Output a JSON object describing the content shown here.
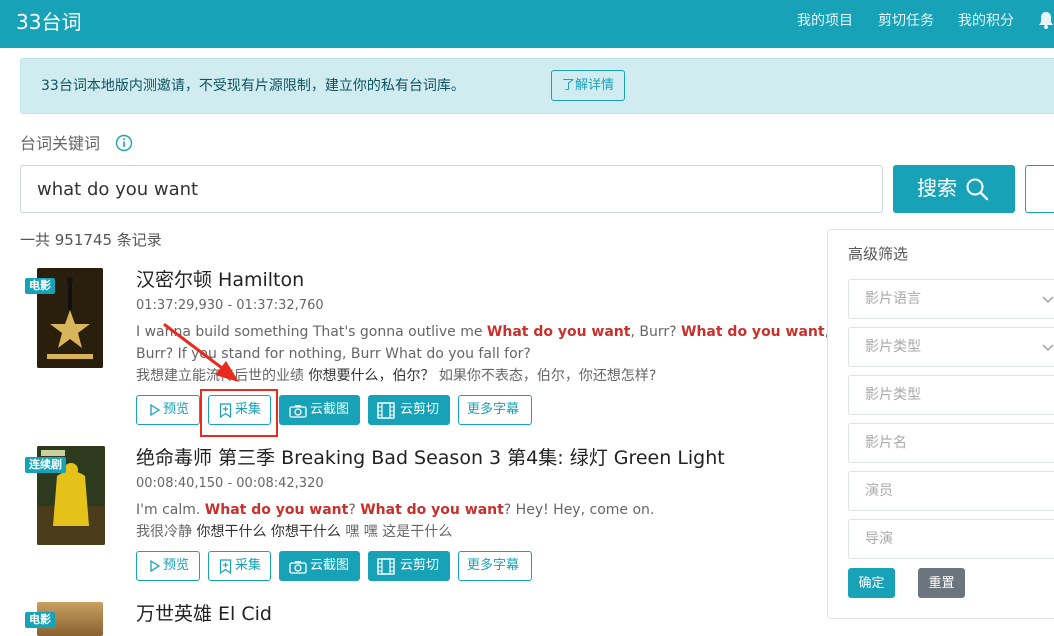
{
  "header": {
    "brand": "33台词",
    "nav": [
      "我的项目",
      "剪切任务",
      "我的积分"
    ],
    "bg_color": "#17a2b8"
  },
  "alert": {
    "text": "33台词本地版内测邀请，不受现有片源限制，建立你的私有台词库。",
    "button": "了解详情"
  },
  "search": {
    "label": "台词关键词",
    "value": "what do you want",
    "button": "搜索",
    "count_text": "一共 951745 条记录"
  },
  "results": [
    {
      "badge": "电影",
      "title": "汉密尔顿 Hamilton",
      "time": "01:37:29,930 - 01:37:32,760",
      "en_line1": [
        "I wanna build something That's gonna outlive me  ",
        "What do you want",
        ", Burr? ",
        "What do you want",
        ","
      ],
      "en_line2": "Burr? If you stand for nothing, Burr What do you fall for?",
      "cn_line": [
        "我想建立能流传后世的业绩  ",
        "你想要什么，伯尔？",
        "  如果你不表态，伯尔，你还想怎样?"
      ],
      "actions": [
        "预览",
        "采集",
        "云截图",
        "云剪切",
        "更多字幕"
      ]
    },
    {
      "badge": "连续剧",
      "title": "绝命毒师 第三季 Breaking Bad Season 3 第4集: 绿灯 Green Light",
      "time": "00:08:40,150 - 00:08:42,320",
      "en_line1": [
        "I'm calm.  ",
        "What do you want",
        "? ",
        "What do you want",
        "? Hey! Hey, come on."
      ],
      "cn_line": [
        "我很冷静  ",
        "你想干什么 你想干什么",
        " 嘿 嘿 这是干什么"
      ],
      "actions": [
        "预览",
        "采集",
        "云截图",
        "云剪切",
        "更多字幕"
      ]
    },
    {
      "badge": "电影",
      "title": "万世英雄 El Cid"
    }
  ],
  "filters": {
    "title": "高级筛选",
    "fields": [
      "影片语言",
      "影片类型",
      "影片类型",
      "影片名",
      "演员",
      "导演"
    ],
    "ok": "确定",
    "reset": "重置"
  },
  "annotation_color": "#e82a1f"
}
